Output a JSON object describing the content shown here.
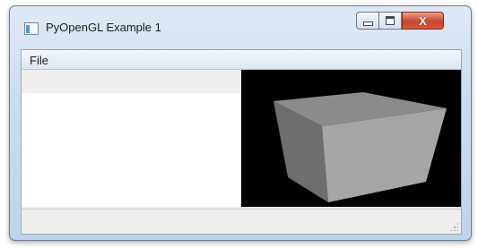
{
  "window": {
    "title": "PyOpenGL Example 1",
    "controls": {
      "minimize_icon": "minimize-icon",
      "maximize_icon": "maximize-icon",
      "close_glyph": "X"
    }
  },
  "menu": {
    "items": [
      {
        "label": "File"
      }
    ]
  },
  "gl_view": {
    "background": "#000000",
    "shape": "cube",
    "face_colors": {
      "top": "#8a8a8a",
      "left": "#6d6d6d",
      "front": "#a5a5a5"
    }
  },
  "colors": {
    "titlebar_accent": "#c7d8ec",
    "close_button": "#c7462b"
  }
}
